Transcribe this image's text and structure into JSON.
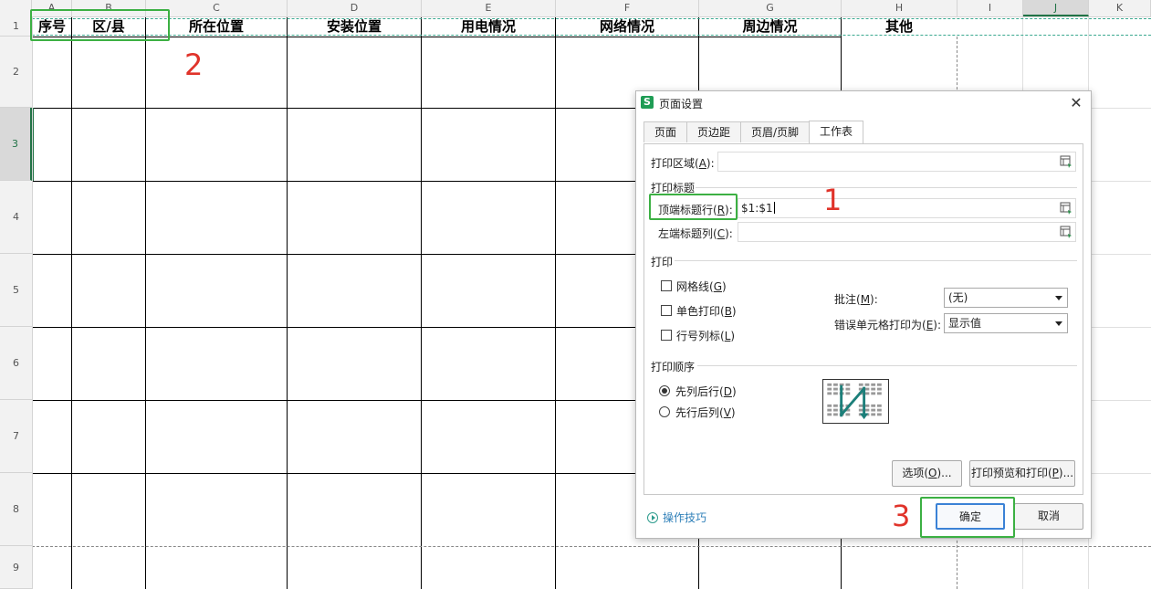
{
  "sheet": {
    "columns": [
      "A",
      "B",
      "C",
      "D",
      "E",
      "F",
      "G",
      "H",
      "I",
      "J",
      "K"
    ],
    "selected_column": "J",
    "rows": [
      "1",
      "2",
      "3",
      "4",
      "5",
      "6",
      "7",
      "8",
      "9"
    ],
    "selected_row": "3",
    "header_row": [
      "序号",
      "区/县",
      "所在位置",
      "安装位置",
      "用电情况",
      "网络情况",
      "周边情况",
      "其他"
    ]
  },
  "dialog": {
    "title": "页面设置",
    "app_icon": "S",
    "close": "✕",
    "tabs": [
      {
        "label": "页面",
        "active": false
      },
      {
        "label": "页边距",
        "active": false
      },
      {
        "label": "页眉/页脚",
        "active": false
      },
      {
        "label": "工作表",
        "active": true
      }
    ],
    "print_area": {
      "label": "打印区域(",
      "key": "A",
      "suffix": "):",
      "value": ""
    },
    "print_titles_section": "打印标题",
    "top_rows": {
      "label": "顶端标题行(",
      "key": "R",
      "suffix": "):",
      "value": "$1:$1"
    },
    "left_cols": {
      "label": "左端标题列(",
      "key": "C",
      "suffix": "):",
      "value": ""
    },
    "print_section": "打印",
    "gridlines": {
      "label": "网格线(",
      "key": "G",
      "suffix": ")",
      "checked": false
    },
    "mono": {
      "label": "单色打印(",
      "key": "B",
      "suffix": ")",
      "checked": false
    },
    "row_col_headings": {
      "label": "行号列标(",
      "key": "L",
      "suffix": ")",
      "checked": false
    },
    "comments": {
      "label": "批注(",
      "key": "M",
      "suffix": "):",
      "value": "(无)"
    },
    "cell_errors": {
      "label": "错误单元格打印为(",
      "key": "E",
      "suffix": "):",
      "value": "显示值"
    },
    "order_section": "打印顺序",
    "order_down_then_over": {
      "label": "先列后行(",
      "key": "D",
      "suffix": ")",
      "selected": true
    },
    "order_over_then_down": {
      "label": "先行后列(",
      "key": "V",
      "suffix": ")",
      "selected": false
    },
    "options_button": {
      "label": "选项(",
      "key": "O",
      "suffix": ")..."
    },
    "preview_button": {
      "label": "打印预览和打印(",
      "key": "P",
      "suffix": ")..."
    },
    "tips": "操作技巧",
    "ok": "确定",
    "cancel": "取消"
  },
  "annotations": [
    "1",
    "2",
    "3"
  ],
  "colors": {
    "annotation_box": "#3cb043",
    "annotation_number": "#e0332a",
    "selection": "#217346",
    "print_title_dash": "#3aa88f"
  }
}
